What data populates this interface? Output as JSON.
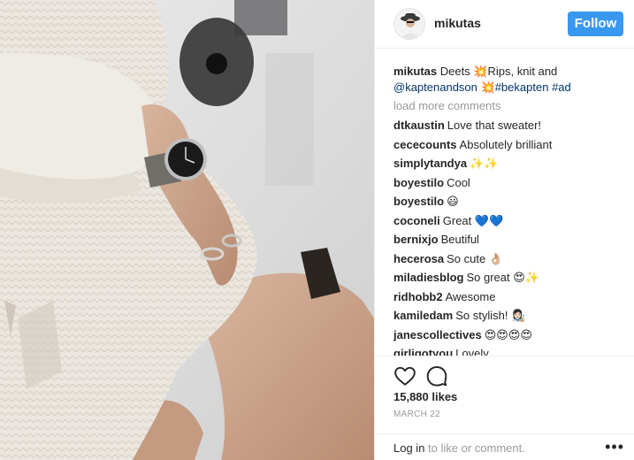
{
  "post": {
    "username": "mikutas",
    "follow_label": "Follow",
    "caption": {
      "username": "mikutas",
      "line1": "Deets 💥Rips, knit and",
      "mention": "@kaptenandson",
      "tags_prefix": " 💥",
      "tag1": "#bekapten",
      "tag2": "#ad"
    },
    "load_more": "load more comments",
    "comments": [
      {
        "user": "dtkaustin",
        "text": "Love that sweater!"
      },
      {
        "user": "cececounts",
        "text": "Absolutely brilliant"
      },
      {
        "user": "simplytandya",
        "text": "✨✨"
      },
      {
        "user": "boyestilo",
        "text": "Cool"
      },
      {
        "user": "boyestilo",
        "text": "😃"
      },
      {
        "user": "coconeli",
        "text": "Great 💙💙"
      },
      {
        "user": "bernixjo",
        "text": "Beutiful"
      },
      {
        "user": "hecerosa",
        "text": "So cute 👌🏼"
      },
      {
        "user": "miladiesblog",
        "text": "So great 😍✨"
      },
      {
        "user": "ridhobb2",
        "text": "Awesome"
      },
      {
        "user": "kamiledam",
        "text": "So stylish! 👩🏻‍🎨"
      },
      {
        "user": "janescollectives",
        "text": "😍😍😍😍"
      },
      {
        "user": "girligotyou",
        "text": "Lovely"
      }
    ],
    "likes": "15,880 likes",
    "date": "MARCH 22",
    "login_link": "Log in",
    "login_rest": " to like or comment.",
    "more_label": "•••"
  },
  "icons": {
    "like": "heart-icon",
    "comment": "comment-icon",
    "more": "more-options-icon"
  },
  "colors": {
    "follow_button": "#3897f0",
    "hashtag": "#003569",
    "muted": "#999999",
    "text": "#262626"
  }
}
